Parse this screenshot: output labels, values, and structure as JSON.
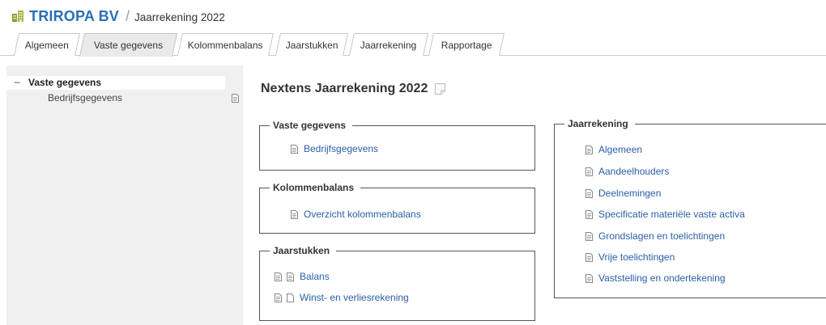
{
  "header": {
    "company": "TRIROPA BV",
    "separator": "/",
    "document_title": "Jaarrekening 2022",
    "company_icon": "building-icon",
    "brand_color": "#2a6fb8"
  },
  "tabs": [
    {
      "label": "Algemeen",
      "active": false
    },
    {
      "label": "Vaste gegevens",
      "active": true
    },
    {
      "label": "Kolommenbalans",
      "active": false
    },
    {
      "label": "Jaarstukken",
      "active": false
    },
    {
      "label": "Jaarrekening",
      "active": false
    },
    {
      "label": "Rapportage",
      "active": false
    }
  ],
  "sidebar": {
    "collapse_symbol": "–",
    "top_label": "Vaste gegevens",
    "sub_label": "Bedrijfsgegevens",
    "sub_icon": "document-icon"
  },
  "main": {
    "title": "Nextens Jaarrekening 2022",
    "title_icon": "note-icon",
    "groups": {
      "vaste_gegevens": {
        "legend": "Vaste gegevens",
        "links": [
          "Bedrijfsgegevens"
        ]
      },
      "kolommenbalans": {
        "legend": "Kolommenbalans",
        "links": [
          "Overzicht kolommenbalans"
        ]
      },
      "jaarstukken": {
        "legend": "Jaarstukken",
        "links": [
          "Balans",
          "Winst- en verliesrekening"
        ]
      },
      "jaarrekening": {
        "legend": "Jaarrekening",
        "links": [
          "Algemeen",
          "Aandeelhouders",
          "Deelnemingen",
          "Specificatie materiële vaste activa",
          "Grondslagen en toelichtingen",
          "Vrije toelichtingen",
          "Vaststelling en ondertekening"
        ]
      }
    }
  },
  "colors": {
    "link": "#2a5ea8",
    "sidebar_bg": "#f0f0f0",
    "active_tab_bg": "#eaeaea"
  }
}
